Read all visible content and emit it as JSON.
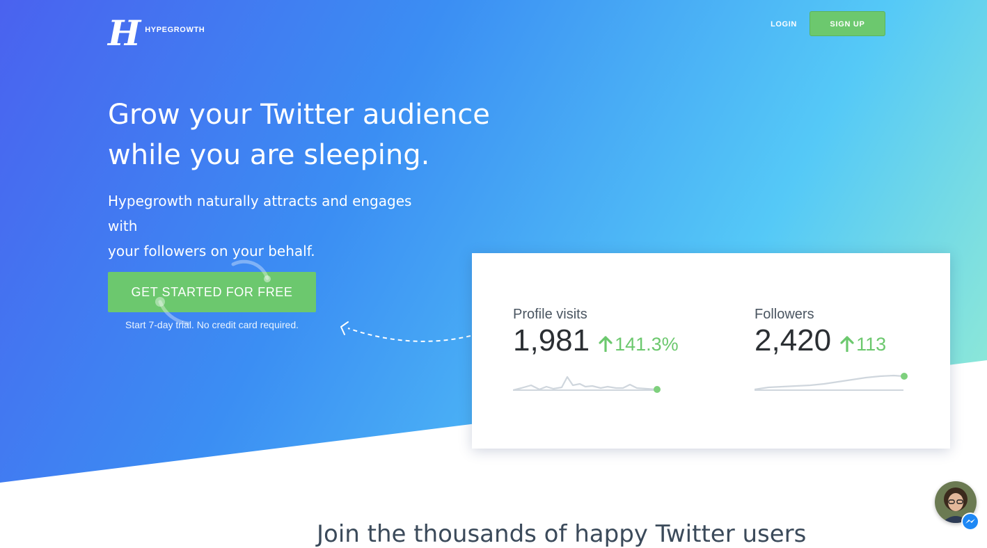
{
  "brand": {
    "mark": "H",
    "name": "HYPEGROWTH"
  },
  "nav": {
    "login": "LOGIN",
    "signup": "SIGN UP"
  },
  "hero": {
    "headline_line1": "Grow your Twitter audience",
    "headline_line2": "while you are sleeping.",
    "subhead_line1": "Hypegrowth naturally attracts and engages with",
    "subhead_line2": "your followers on your behalf.",
    "cta": "GET STARTED FOR FREE",
    "cta_note": "Start 7-day trial. No credit card required."
  },
  "stats": {
    "visits": {
      "label": "Profile visits",
      "value": "1,981",
      "delta": "141.3%"
    },
    "followers": {
      "label": "Followers",
      "value": "2,420",
      "delta": "113"
    }
  },
  "section_peek": "Join the thousands of happy Twitter users",
  "colors": {
    "gradient_start": "#4a62ef",
    "gradient_mid": "#3a96f4",
    "gradient_end": "#5ccff5",
    "gradient_green": "#9cf0cf",
    "accent_green": "#6cc86e",
    "sparkline_gray": "#cfd6dd"
  },
  "icons": {
    "logo": "hypegrowth-logo-icon",
    "arrow_up": "arrow-up-icon",
    "dashed_arrow": "dashed-arrow-icon",
    "messenger": "messenger-icon"
  }
}
